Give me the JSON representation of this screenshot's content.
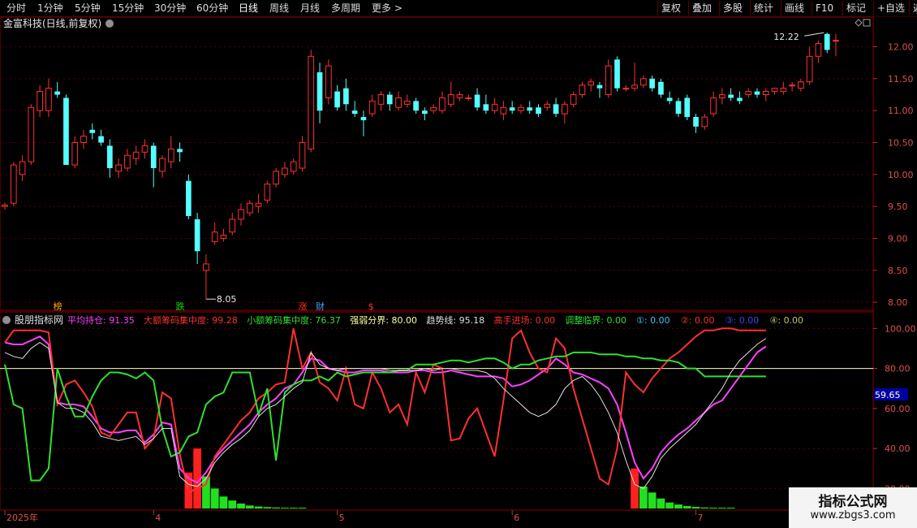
{
  "toolbar": {
    "periods": [
      "分时",
      "1分钟",
      "5分钟",
      "15分钟",
      "30分钟",
      "60分钟",
      "日线",
      "周线",
      "月线",
      "多周期",
      "更多 >"
    ],
    "active_period": "日线",
    "right_buttons": [
      "复权",
      "叠加",
      "多股",
      "统计",
      "画线",
      "F10",
      "标记",
      "+自选",
      "返回"
    ]
  },
  "main_panel": {
    "title": "金富科技(日线,前复权)",
    "high_label": "12.22",
    "low_label": "8.05",
    "diamond_icon": "diamond-icon"
  },
  "markers": [
    {
      "text": "榜",
      "color": "#ffb000",
      "index": 6
    },
    {
      "text": "跌",
      "color": "#00e000",
      "index": 20
    },
    {
      "text": "涨",
      "color": "#ff3030",
      "index": 34
    },
    {
      "text": "财",
      "color": "#40a0ff",
      "index": 36
    },
    {
      "text": "$",
      "color": "#ff3030",
      "index": 42
    }
  ],
  "indicator": {
    "name": "股朋指标网",
    "items": [
      {
        "label": "平均持仓:",
        "value": "91.35",
        "color": "#ff40ff"
      },
      {
        "label": "大额筹码集中度:",
        "value": "99.28",
        "color": "#ff3030"
      },
      {
        "label": "小额筹码集中度:",
        "value": "76.37",
        "color": "#30e030"
      },
      {
        "label": "强弱分界:",
        "value": "80.00",
        "color": "#ffffa0"
      },
      {
        "label": "趋势线:",
        "value": "95.18",
        "color": "#e0e0e0"
      },
      {
        "label": "高手进场:",
        "value": "0.00",
        "color": "#ff3030"
      },
      {
        "label": "调整临界:",
        "value": "0.00",
        "color": "#30e030"
      },
      {
        "label": "①:",
        "value": "0.00",
        "color": "#40c0ff"
      },
      {
        "label": "②:",
        "value": "0.00",
        "color": "#ff3030"
      },
      {
        "label": "③:",
        "value": "0.00",
        "color": "#4040ff"
      },
      {
        "label": "④:",
        "value": "0.00",
        "color": "#c0c060"
      }
    ],
    "cursor_value": "59.65"
  },
  "x_axis_labels": [
    {
      "text": "2025年",
      "index": 0
    },
    {
      "text": "4",
      "index": 17
    },
    {
      "text": "5",
      "index": 38
    },
    {
      "text": "6",
      "index": 58
    },
    {
      "text": "7",
      "index": 79
    }
  ],
  "watermark": {
    "line1": "指标公式网",
    "line2": "www.zbgs3.com"
  },
  "chart_data": [
    {
      "type": "candlestick",
      "title": "金富科技(日线,前复权)",
      "ylim": [
        7.9,
        12.35
      ],
      "yticks": [
        8.0,
        8.5,
        9.0,
        9.5,
        10.0,
        10.5,
        11.0,
        11.5,
        12.0
      ],
      "ohlc": [
        [
          9.5,
          9.56,
          9.45,
          9.52
        ],
        [
          9.55,
          10.2,
          9.5,
          10.15
        ],
        [
          10.0,
          10.3,
          9.9,
          10.2
        ],
        [
          10.2,
          11.1,
          10.15,
          11.05
        ],
        [
          11.0,
          11.4,
          10.9,
          11.3
        ],
        [
          11.0,
          11.5,
          10.9,
          11.35
        ],
        [
          11.3,
          11.45,
          11.2,
          11.25
        ],
        [
          11.2,
          11.25,
          10.2,
          10.15
        ],
        [
          10.15,
          10.6,
          10.1,
          10.5
        ],
        [
          10.5,
          10.7,
          10.4,
          10.6
        ],
        [
          10.7,
          10.8,
          10.55,
          10.65
        ],
        [
          10.6,
          10.7,
          10.45,
          10.5
        ],
        [
          10.45,
          10.55,
          9.95,
          10.1
        ],
        [
          10.05,
          10.25,
          9.95,
          10.15
        ],
        [
          10.1,
          10.4,
          10.05,
          10.3
        ],
        [
          10.25,
          10.45,
          10.15,
          10.35
        ],
        [
          10.35,
          10.55,
          10.25,
          10.45
        ],
        [
          10.45,
          10.5,
          9.8,
          10.1
        ],
        [
          10.05,
          10.3,
          9.95,
          10.25
        ],
        [
          10.2,
          10.6,
          10.1,
          10.4
        ],
        [
          10.4,
          10.5,
          10.2,
          10.35
        ],
        [
          9.9,
          10.0,
          9.3,
          9.35
        ],
        [
          9.3,
          9.4,
          8.6,
          8.8
        ],
        [
          8.5,
          8.75,
          8.05,
          8.6
        ],
        [
          8.95,
          9.25,
          8.9,
          9.1
        ],
        [
          9.0,
          9.15,
          8.95,
          9.05
        ],
        [
          9.1,
          9.4,
          9.05,
          9.3
        ],
        [
          9.3,
          9.55,
          9.2,
          9.45
        ],
        [
          9.4,
          9.6,
          9.35,
          9.55
        ],
        [
          9.5,
          9.7,
          9.4,
          9.55
        ],
        [
          9.6,
          9.9,
          9.55,
          9.85
        ],
        [
          9.85,
          10.1,
          9.8,
          10.05
        ],
        [
          10.0,
          10.2,
          9.95,
          10.1
        ],
        [
          10.05,
          10.25,
          10.0,
          10.2
        ],
        [
          10.1,
          10.6,
          10.05,
          10.5
        ],
        [
          10.4,
          11.95,
          10.35,
          11.85
        ],
        [
          11.6,
          11.75,
          10.8,
          11.0
        ],
        [
          11.2,
          11.8,
          11.1,
          11.7
        ],
        [
          11.3,
          11.4,
          11.0,
          11.05
        ],
        [
          11.35,
          11.5,
          11.0,
          11.1
        ],
        [
          11.0,
          11.15,
          10.9,
          10.95
        ],
        [
          10.9,
          11.0,
          10.6,
          10.85
        ],
        [
          10.95,
          11.25,
          10.9,
          11.15
        ],
        [
          11.1,
          11.3,
          11.0,
          11.25
        ],
        [
          11.25,
          11.3,
          11.0,
          11.1
        ],
        [
          11.05,
          11.3,
          11.0,
          11.2
        ],
        [
          11.1,
          11.25,
          11.05,
          11.15
        ],
        [
          11.15,
          11.2,
          10.95,
          11.0
        ],
        [
          11.0,
          11.05,
          10.85,
          10.95
        ],
        [
          11.0,
          11.1,
          10.95,
          11.05
        ],
        [
          11.0,
          11.3,
          10.95,
          11.2
        ],
        [
          11.1,
          11.45,
          11.05,
          11.25
        ],
        [
          11.2,
          11.3,
          11.15,
          11.25
        ],
        [
          11.2,
          11.25,
          11.15,
          11.2
        ],
        [
          11.25,
          11.35,
          11.0,
          11.05
        ],
        [
          11.1,
          11.25,
          10.95,
          11.0
        ],
        [
          11.0,
          11.2,
          10.95,
          11.1
        ],
        [
          10.95,
          11.15,
          10.85,
          11.05
        ],
        [
          11.05,
          11.15,
          10.95,
          11.0
        ],
        [
          11.0,
          11.1,
          10.95,
          11.05
        ],
        [
          11.05,
          11.15,
          10.95,
          11.0
        ],
        [
          11.05,
          11.1,
          10.9,
          10.95
        ],
        [
          11.05,
          11.15,
          11.0,
          11.1
        ],
        [
          11.1,
          11.2,
          10.9,
          10.95
        ],
        [
          10.95,
          11.15,
          10.8,
          11.1
        ],
        [
          11.1,
          11.3,
          11.05,
          11.25
        ],
        [
          11.25,
          11.45,
          11.2,
          11.4
        ],
        [
          11.4,
          11.5,
          11.3,
          11.45
        ],
        [
          11.4,
          11.45,
          11.2,
          11.35
        ],
        [
          11.25,
          11.8,
          11.2,
          11.7
        ],
        [
          11.8,
          11.85,
          11.3,
          11.35
        ],
        [
          11.35,
          11.4,
          11.3,
          11.35
        ],
        [
          11.35,
          11.75,
          11.3,
          11.4
        ],
        [
          11.4,
          11.55,
          11.35,
          11.5
        ],
        [
          11.5,
          11.55,
          11.3,
          11.35
        ],
        [
          11.45,
          11.5,
          11.2,
          11.25
        ],
        [
          11.2,
          11.3,
          11.1,
          11.15
        ],
        [
          11.15,
          11.2,
          10.9,
          10.95
        ],
        [
          11.2,
          11.25,
          10.85,
          10.9
        ],
        [
          10.9,
          10.95,
          10.65,
          10.75
        ],
        [
          10.75,
          10.95,
          10.7,
          10.9
        ],
        [
          10.95,
          11.3,
          10.9,
          11.2
        ],
        [
          11.2,
          11.35,
          11.1,
          11.25
        ],
        [
          11.25,
          11.35,
          11.15,
          11.2
        ],
        [
          11.2,
          11.3,
          11.1,
          11.15
        ],
        [
          11.25,
          11.35,
          11.2,
          11.3
        ],
        [
          11.3,
          11.35,
          11.2,
          11.25
        ],
        [
          11.25,
          11.35,
          11.15,
          11.3
        ],
        [
          11.3,
          11.35,
          11.25,
          11.35
        ],
        [
          11.3,
          11.45,
          11.25,
          11.35
        ],
        [
          11.4,
          11.45,
          11.3,
          11.4
        ],
        [
          11.35,
          11.5,
          11.3,
          11.45
        ],
        [
          11.45,
          12.0,
          11.4,
          11.85
        ],
        [
          11.85,
          12.1,
          11.75,
          12.05
        ],
        [
          12.2,
          12.22,
          11.9,
          11.95
        ],
        [
          12.1,
          12.2,
          11.85,
          12.1
        ]
      ]
    },
    {
      "type": "line",
      "title": "股朋指标网",
      "ylim": [
        10,
        105
      ],
      "yticks": [
        20,
        40,
        60,
        80,
        100
      ],
      "threshold": 80,
      "series": [
        {
          "name": "平均持仓",
          "color": "#ff40ff",
          "values": [
            93,
            92,
            92,
            94,
            96,
            92,
            63,
            62,
            62,
            61,
            56,
            50,
            48,
            48,
            49,
            49,
            43,
            47,
            53,
            52,
            30,
            25,
            23,
            28,
            35,
            40,
            44,
            48,
            52,
            58,
            62,
            65,
            70,
            72,
            78,
            85,
            84,
            80,
            79,
            78,
            78,
            79,
            79,
            79,
            78,
            78,
            78,
            79,
            79,
            78,
            78,
            79,
            78,
            77,
            76,
            76,
            76,
            75,
            71,
            72,
            74,
            77,
            80,
            85,
            82,
            78,
            77,
            75,
            73,
            70,
            62,
            48,
            33,
            25,
            30,
            38,
            43,
            47,
            50,
            54,
            58,
            62,
            64,
            70,
            76,
            82,
            88,
            91
          ]
        },
        {
          "name": "大额筹码集中度",
          "color": "#ff3030",
          "values": [
            93,
            99,
            99,
            99,
            99,
            98,
            62,
            72,
            74,
            68,
            61,
            48,
            46,
            52,
            58,
            58,
            40,
            45,
            68,
            65,
            37,
            18,
            20,
            22,
            36,
            42,
            48,
            54,
            58,
            65,
            68,
            72,
            73,
            100,
            80,
            88,
            73,
            70,
            64,
            80,
            62,
            60,
            78,
            70,
            58,
            62,
            52,
            78,
            68,
            82,
            80,
            44,
            45,
            55,
            60,
            48,
            36,
            64,
            95,
            99,
            88,
            80,
            78,
            95,
            90,
            70,
            55,
            40,
            25,
            22,
            40,
            78,
            72,
            68,
            75,
            80,
            85,
            88,
            92,
            96,
            99,
            99,
            100,
            100,
            99,
            99,
            99,
            99
          ]
        },
        {
          "name": "小额筹码集中度",
          "color": "#30e030",
          "values": [
            82,
            62,
            60,
            24,
            24,
            30,
            80,
            66,
            56,
            56,
            66,
            74,
            78,
            78,
            77,
            75,
            78,
            74,
            50,
            36,
            38,
            46,
            48,
            62,
            66,
            68,
            78,
            78,
            78,
            57,
            70,
            34,
            68,
            72,
            74,
            74,
            76,
            74,
            78,
            76,
            77,
            78,
            78,
            78,
            78,
            79,
            79,
            82,
            82,
            82,
            83,
            84,
            84,
            83,
            84,
            85,
            85,
            83,
            80,
            82,
            82,
            84,
            85,
            86,
            86,
            88,
            88,
            88,
            87,
            87,
            87,
            86,
            86,
            85,
            85,
            84,
            84,
            83,
            80,
            80,
            76,
            76,
            76,
            76,
            76,
            76,
            76,
            76
          ]
        },
        {
          "name": "趋势线",
          "color": "#e0e0e0",
          "values": [
            88,
            86,
            85,
            90,
            93,
            90,
            63,
            60,
            60,
            58,
            53,
            46,
            45,
            44,
            45,
            46,
            42,
            45,
            50,
            50,
            26,
            22,
            21,
            25,
            33,
            38,
            42,
            45,
            49,
            56,
            60,
            62,
            66,
            70,
            73,
            88,
            82,
            80,
            79,
            80,
            80,
            80,
            80,
            80,
            79,
            79,
            79,
            79,
            80,
            79,
            80,
            80,
            79,
            79,
            79,
            78,
            75,
            70,
            66,
            62,
            58,
            56,
            58,
            62,
            70,
            74,
            76,
            72,
            66,
            58,
            48,
            34,
            22,
            20,
            26,
            35,
            40,
            44,
            48,
            52,
            58,
            64,
            70,
            78,
            84,
            88,
            92,
            95
          ]
        }
      ],
      "bars": {
        "高手进场": [
          0,
          0,
          0,
          0,
          0,
          0,
          0,
          0,
          0,
          0,
          0,
          0,
          0,
          0,
          0,
          0,
          0,
          0,
          0,
          0,
          0,
          18,
          30,
          0,
          0,
          0,
          0,
          0,
          0,
          0,
          0,
          0,
          0,
          0,
          0,
          0,
          0,
          0,
          0,
          0,
          0,
          0,
          0,
          0,
          0,
          0,
          0,
          0,
          0,
          0,
          0,
          0,
          0,
          0,
          0,
          0,
          0,
          0,
          0,
          0,
          0,
          0,
          0,
          0,
          0,
          0,
          0,
          0,
          0,
          0,
          0,
          0,
          20,
          0,
          0,
          0,
          0,
          0,
          0,
          0,
          0,
          0,
          0,
          0,
          0,
          0,
          0,
          0
        ],
        "调整临界": [
          0,
          0,
          0,
          0,
          0,
          0,
          0,
          0,
          0,
          0,
          0,
          0,
          0,
          0,
          0,
          0,
          0,
          0,
          0,
          0,
          0,
          0,
          0,
          16,
          10,
          6,
          4,
          2.5,
          1.5,
          1,
          0.7,
          0.5,
          0.3,
          0.2,
          0.1,
          0,
          0,
          0,
          0,
          0,
          0,
          0,
          0,
          0,
          0,
          0,
          0,
          0,
          0,
          0,
          0,
          0,
          0,
          0,
          0,
          0,
          0,
          0,
          0,
          0,
          0,
          0,
          0,
          0,
          0,
          0,
          0,
          0,
          0,
          0,
          0,
          0,
          0,
          11,
          8,
          5,
          3,
          2,
          1.2,
          0.8,
          0.5,
          0.3,
          0.2,
          0.1,
          0,
          0,
          0,
          0
        ]
      }
    }
  ]
}
